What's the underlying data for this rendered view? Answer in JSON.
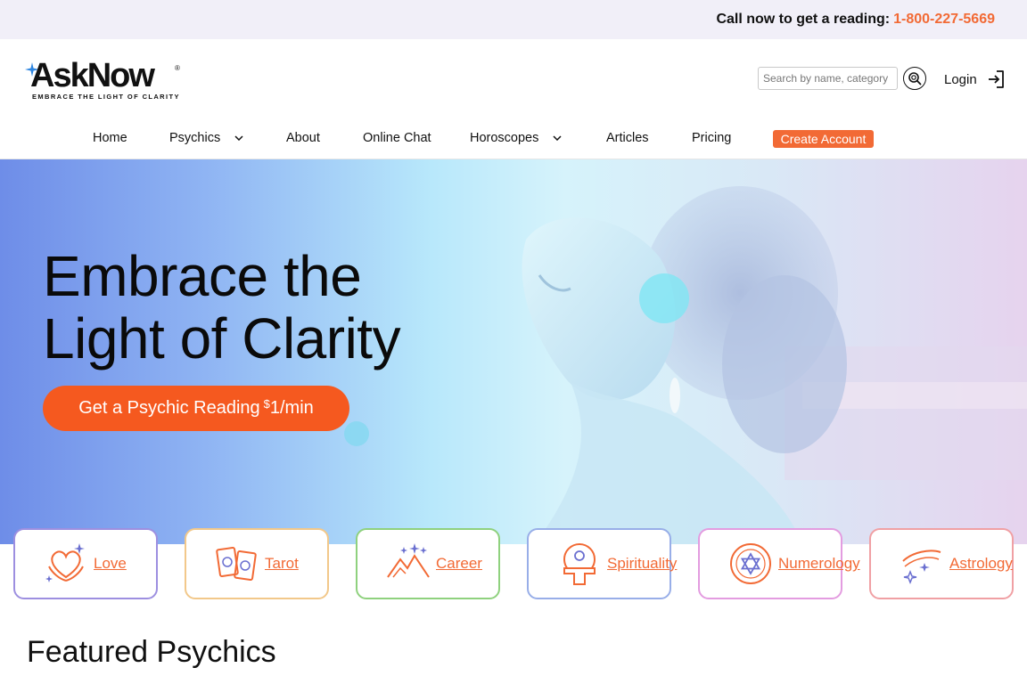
{
  "topbar": {
    "call_text": "Call now to get a reading:",
    "phone": "1-800-227-5669"
  },
  "logo": {
    "name": "AskNow",
    "tagline": "EMBRACE THE LIGHT OF CLARITY",
    "reg": "®"
  },
  "search": {
    "placeholder": "Search by name, category",
    "icon": "search-icon"
  },
  "login": {
    "label": "Login",
    "icon": "login-icon"
  },
  "nav": {
    "items": [
      {
        "label": "Home"
      },
      {
        "label": "Psychics",
        "dropdown": true
      },
      {
        "label": "About"
      },
      {
        "label": "Online Chat"
      },
      {
        "label": "Horoscopes",
        "dropdown": true
      },
      {
        "label": "Articles"
      },
      {
        "label": "Pricing"
      }
    ],
    "cta": "Create Account"
  },
  "hero": {
    "title_line1": "Embrace the",
    "title_line2": "Light of Clarity",
    "cta_text": "Get a Psychic Reading",
    "cta_currency": "$",
    "cta_price": "1/min"
  },
  "categories": [
    {
      "label": "Love",
      "icon": "heart-hands-icon",
      "border": "#9d8fe0"
    },
    {
      "label": "Tarot",
      "icon": "tarot-cards-icon",
      "border": "#f2c88a"
    },
    {
      "label": "Career",
      "icon": "mountain-icon",
      "border": "#8fd17e"
    },
    {
      "label": "Spirituality",
      "icon": "meditation-icon",
      "border": "#98aee8"
    },
    {
      "label": "Numerology",
      "icon": "star-of-david-icon",
      "border": "#e39ce0"
    },
    {
      "label": "Astrology",
      "icon": "comet-icon",
      "border": "#f0a0a4"
    }
  ],
  "featured": {
    "title": "Featured Psychics"
  },
  "colors": {
    "accent": "#f26a35",
    "cta": "#f5591f",
    "topbar_bg": "#f1eff8"
  }
}
